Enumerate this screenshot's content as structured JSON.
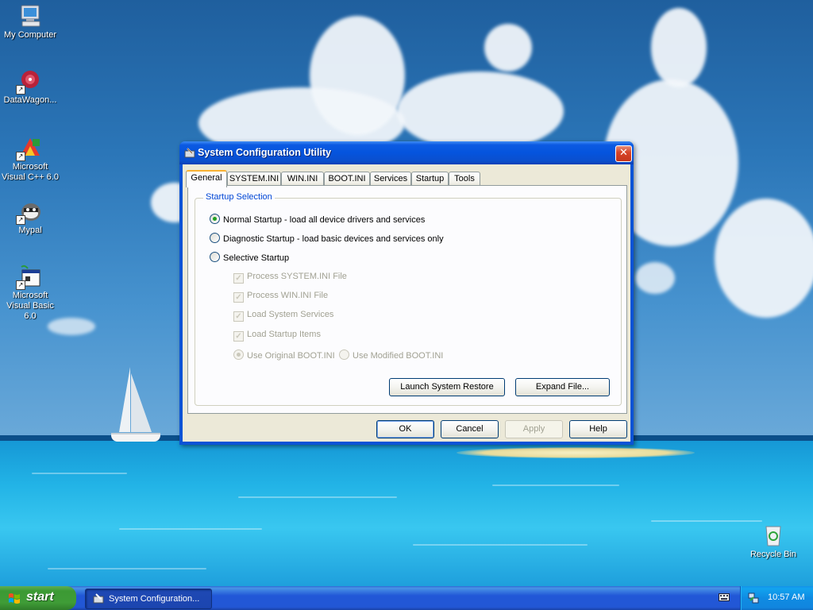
{
  "desktop": {
    "icons": [
      {
        "label": "My Computer"
      },
      {
        "label": "DataWagon..."
      },
      {
        "label": "Microsoft Visual C++ 6.0"
      },
      {
        "label": "Mypal"
      },
      {
        "label": "Microsoft Visual Basic 6.0"
      },
      {
        "label": "Recycle Bin"
      }
    ]
  },
  "dialog": {
    "title": "System Configuration Utility",
    "close_label": "✕",
    "tabs": [
      {
        "label": "General"
      },
      {
        "label": "SYSTEM.INI"
      },
      {
        "label": "WIN.INI"
      },
      {
        "label": "BOOT.INI"
      },
      {
        "label": "Services"
      },
      {
        "label": "Startup"
      },
      {
        "label": "Tools"
      }
    ],
    "active_tab": "General",
    "group_title": "Startup Selection",
    "radios": {
      "normal": {
        "label": "Normal Startup - load all device drivers and services",
        "checked": true
      },
      "diagnostic": {
        "label": "Diagnostic Startup - load basic devices and services only",
        "checked": false
      },
      "selective": {
        "label": "Selective Startup",
        "checked": false
      }
    },
    "checkboxes": [
      {
        "label": "Process SYSTEM.INI File",
        "checked": true,
        "enabled": false
      },
      {
        "label": "Process WIN.INI File",
        "checked": true,
        "enabled": false
      },
      {
        "label": "Load System Services",
        "checked": true,
        "enabled": false
      },
      {
        "label": "Load Startup Items",
        "checked": true,
        "enabled": false
      }
    ],
    "boot_options": {
      "original": {
        "label": "Use Original BOOT.INI",
        "checked": true,
        "enabled": false
      },
      "modified": {
        "label": "Use Modified BOOT.INI",
        "checked": false,
        "enabled": false
      }
    },
    "panel_buttons": {
      "launch_restore": "Launch System Restore",
      "expand_file": "Expand File..."
    },
    "footer_buttons": {
      "ok": "OK",
      "cancel": "Cancel",
      "apply": "Apply",
      "help": "Help"
    }
  },
  "taskbar": {
    "start_label": "start",
    "task_item": "System Configuration...",
    "clock": "10:57 AM"
  },
  "colors": {
    "title_blue": "#0554dd",
    "group_title_blue": "#0046d5",
    "start_green": "#3c9a34",
    "tab_highlight": "#f9b233"
  }
}
